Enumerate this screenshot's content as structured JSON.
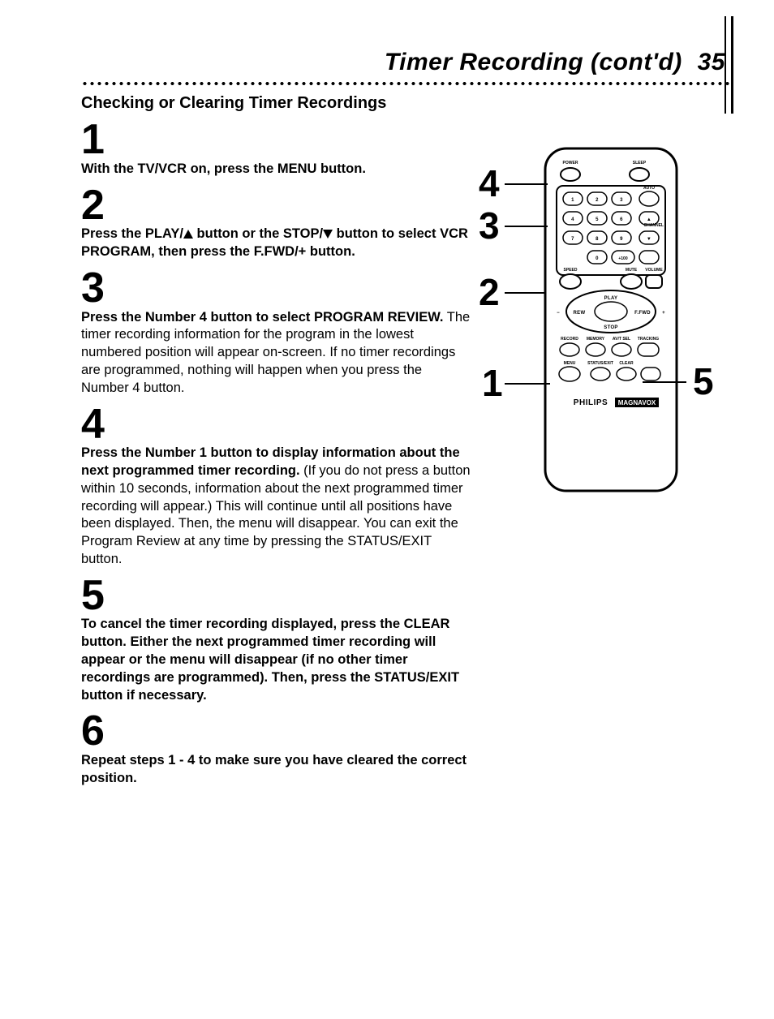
{
  "header": {
    "title": "Timer Recording (cont'd)",
    "page": "35"
  },
  "section_title": "Checking or Clearing Timer Recordings",
  "steps": {
    "s1": {
      "num": "1",
      "bold": "With the TV/VCR on, press the MENU button."
    },
    "s2": {
      "num": "2",
      "bold_a": "Press the PLAY/",
      "bold_b": " button or the STOP/",
      "bold_c": " button to select VCR PROGRAM, then press the F.FWD/+ button."
    },
    "s3": {
      "num": "3",
      "bold": "Press the Number 4 button to select PROGRAM REVIEW.",
      "rest": " The timer recording information for the program in the lowest numbered position will appear on-screen. If no timer recordings are programmed, nothing will happen when you press the Number 4 button."
    },
    "s4": {
      "num": "4",
      "bold": "Press the Number 1 button to display information about the next programmed timer recording.",
      "rest": " (If you do not press a button within 10 seconds, information about the next programmed timer recording will appear.) This will continue until all positions have been displayed. Then, the menu will disappear. You can exit the Program Review at any time by pressing the STATUS/EXIT button."
    },
    "s5": {
      "num": "5",
      "bold": "To cancel the timer recording displayed, press the CLEAR button. Either the next programmed timer recording will appear or the menu will disappear (if no other timer recordings are programmed). Then, press the STATUS/EXIT button if necessary."
    },
    "s6": {
      "num": "6",
      "bold": "Repeat steps 1 - 4 to make sure you have cleared the correct position."
    }
  },
  "callouts": {
    "c1": "1",
    "c2": "2",
    "c3": "3",
    "c4": "4",
    "c5": "5"
  },
  "remote": {
    "power": "POWER",
    "sleep": "SLEEP",
    "auto": "AUTO",
    "n1": "1",
    "n2": "2",
    "n3": "3",
    "n4": "4",
    "n5": "5",
    "n6": "6",
    "n7": "7",
    "n8": "8",
    "n9": "9",
    "n0": "0",
    "n100": "+100",
    "volume": "VOLUME",
    "channel": "CHANNEL",
    "mute": "MUTE",
    "speed": "SPEED",
    "play": "PLAY",
    "rew": "REW",
    "ffwd": "F.FWD",
    "stop": "STOP",
    "record": "RECORD",
    "memory": "MEMORY",
    "avsel": "AV/T SEL",
    "track": "TRACKING",
    "menu": "MENU",
    "status": "STATUS/EXIT",
    "clear": "CLEAR",
    "brand": "PHILIPS",
    "brand2": "MAGNAVOX"
  }
}
